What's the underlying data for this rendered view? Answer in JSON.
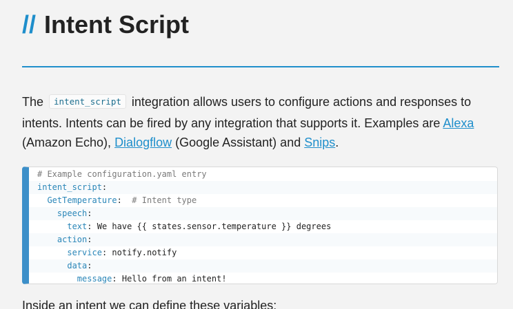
{
  "page": {
    "title_prefix": "//",
    "title": "Intent Script"
  },
  "intro": {
    "text_1": "The ",
    "code_term": "intent_script",
    "text_2": " integration allows users to configure actions and responses to intents. Intents can be fired by any integration that supports it. Examples are ",
    "link_alexa": "Alexa",
    "text_3": " (Amazon Echo), ",
    "link_dialogflow": "Dialogflow",
    "text_4": " (Google Assistant) and ",
    "link_snips": "Snips",
    "text_5": "."
  },
  "code": {
    "lines": [
      {
        "indent": "",
        "key": "",
        "value": "",
        "comment": "# Example configuration.yaml entry"
      },
      {
        "indent": "",
        "key": "intent_script",
        "value": "",
        "comment": ""
      },
      {
        "indent": "  ",
        "key": "GetTemperature",
        "value": "",
        "comment": "# Intent type"
      },
      {
        "indent": "    ",
        "key": "speech",
        "value": "",
        "comment": ""
      },
      {
        "indent": "      ",
        "key": "text",
        "value": "We have {{ states.sensor.temperature }} degrees",
        "comment": ""
      },
      {
        "indent": "    ",
        "key": "action",
        "value": "",
        "comment": ""
      },
      {
        "indent": "      ",
        "key": "service",
        "value": "notify.notify",
        "comment": ""
      },
      {
        "indent": "      ",
        "key": "data",
        "value": "",
        "comment": ""
      },
      {
        "indent": "        ",
        "key": "message",
        "value": "Hello from an intent!",
        "comment": ""
      }
    ]
  },
  "outro": {
    "text": "Inside an intent we can define these variables:"
  },
  "colors": {
    "accent": "#1e8ecb",
    "code_key": "#2a86b8",
    "code_border": "#3c8fc9",
    "background": "#f3f3f3"
  }
}
